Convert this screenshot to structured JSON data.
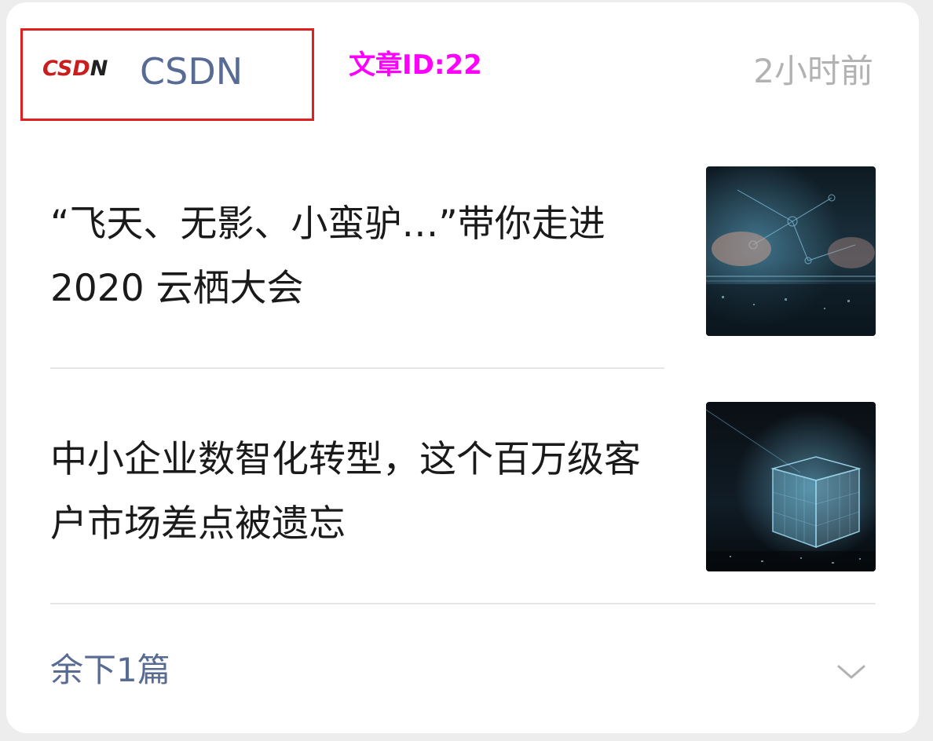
{
  "header": {
    "logo_text_main": "CSD",
    "logo_text_end": "N",
    "source_name": "CSDN",
    "article_id": "文章ID:22",
    "time": "2小时前"
  },
  "articles": [
    {
      "title": "“飞天、无影、小蛮驴…”带你走进 2020 云栖大会",
      "thumb_icon": "tech-hands-image"
    },
    {
      "title": "中小企业数智化转型，这个百万级客户市场差点被遗忘",
      "thumb_icon": "digital-cube-image"
    }
  ],
  "footer": {
    "more_label": "余下1篇",
    "expand_icon": "chevron-down-icon"
  },
  "colors": {
    "link_blue": "#576b95",
    "highlight_red": "#e02020",
    "id_magenta": "#ff00ff",
    "time_gray": "#b2b2b2"
  }
}
